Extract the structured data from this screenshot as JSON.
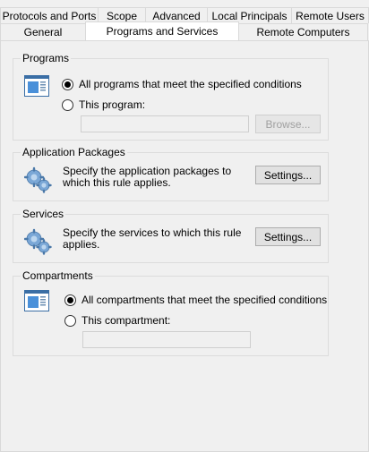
{
  "tabs": {
    "back_row": [
      "Protocols and Ports",
      "Scope",
      "Advanced",
      "Local Principals",
      "Remote Users"
    ],
    "front_row": [
      "General",
      "Programs and Services",
      "Remote Computers"
    ],
    "selected": "Programs and Services"
  },
  "programs": {
    "title": "Programs",
    "option_all": "All programs that meet the specified conditions",
    "option_this": "This program:",
    "program_value": "",
    "browse_label": "Browse..."
  },
  "app_packages": {
    "title": "Application Packages",
    "description": "Specify the application packages to which this rule applies.",
    "settings_label": "Settings..."
  },
  "services": {
    "title": "Services",
    "description": "Specify the services to which this rule applies.",
    "settings_label": "Settings..."
  },
  "compartments": {
    "title": "Compartments",
    "option_all": "All compartments that meet the specified conditions",
    "option_this": "This compartment:",
    "compartment_value": ""
  },
  "icons": {
    "program": "program-window-icon",
    "gear": "gears-icon",
    "compartment": "compartment-window-icon"
  }
}
